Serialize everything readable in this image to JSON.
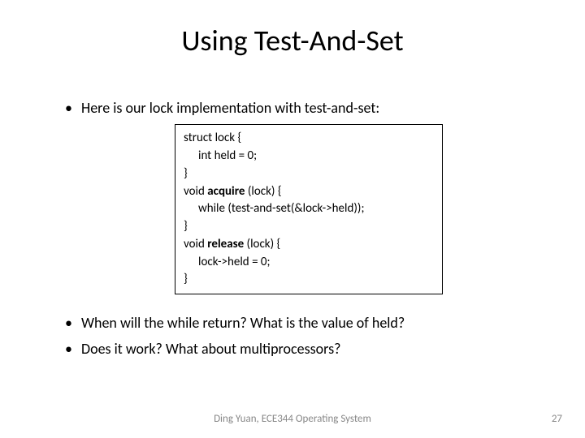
{
  "title": "Using Test-And-Set",
  "bullets": {
    "intro": "Here is our lock implementation with test-and-set:",
    "q1": "When will the while return?  What is the value of held?",
    "q2": "Does it work? What about multiprocessors?"
  },
  "code": {
    "l1a": "struct lock {",
    "l2a": "int held = 0;",
    "l3a": "}",
    "l4a": "void ",
    "l4b": "acquire",
    "l4c": " (lock) {",
    "l5a": "while (test-and-set(&lock->held));",
    "l6a": "}",
    "l7a": "void ",
    "l7b": "release",
    "l7c": " (lock) {",
    "l8a": "lock->held = 0;",
    "l9a": "}"
  },
  "footer": "Ding Yuan, ECE344 Operating System",
  "page": "27"
}
